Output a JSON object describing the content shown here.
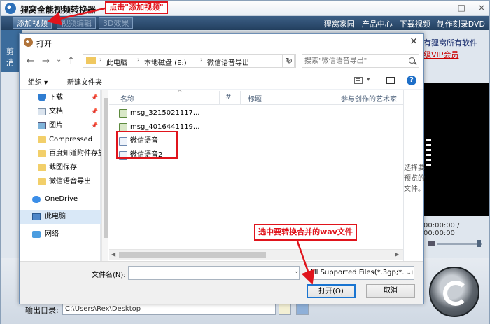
{
  "app": {
    "title": "狸窝全能视频转换器",
    "window_controls": [
      "—",
      "□",
      "×"
    ],
    "toolbar": [
      {
        "label": "添加视频",
        "enabled": true
      },
      {
        "label": "视频编辑",
        "enabled": false
      },
      {
        "label": "3D效果",
        "enabled": false
      }
    ],
    "topnav": [
      "狸窝家园",
      "产品中心",
      "下载视频",
      "制作刻录DVD"
    ],
    "left_strip": [
      "剪",
      "消"
    ],
    "promo_lines": [
      "有狸窝所有软件",
      "级VIP会员"
    ],
    "timecode": "00:00:00 / 00:00:00",
    "output_label": "输出目录:",
    "output_path": "C:\\Users\\Rex\\Desktop"
  },
  "annotations": {
    "step1": "点击\"添加视频\"",
    "step2": "选中要转换合并的wav文件"
  },
  "dialog": {
    "title": "打开",
    "close": "×",
    "nav": {
      "back": "←",
      "forward": "→",
      "down": "⌄",
      "up": "↑"
    },
    "breadcrumb": [
      "此电脑",
      "本地磁盘 (E:)",
      "微信语音导出"
    ],
    "refresh": "↻",
    "search_placeholder": "搜索\"微信语音导出\"",
    "commands": {
      "organize": "组织 ▾",
      "new_folder": "新建文件夹",
      "view_drop": "▾",
      "help": "?"
    },
    "sidebar": [
      {
        "label": "下载",
        "icon": "download-icon",
        "pinned": true
      },
      {
        "label": "文档",
        "icon": "document-icon",
        "pinned": true
      },
      {
        "label": "图片",
        "icon": "picture-icon",
        "pinned": true
      },
      {
        "label": "Compressed",
        "icon": "folder-icon",
        "pinned": false
      },
      {
        "label": "百度知道附件存放",
        "icon": "folder-icon",
        "pinned": false
      },
      {
        "label": "截图保存",
        "icon": "folder-icon",
        "pinned": false
      },
      {
        "label": "微信语音导出",
        "icon": "folder-icon",
        "pinned": false
      },
      {
        "label": "OneDrive",
        "icon": "cloud-icon",
        "pinned": false
      },
      {
        "label": "此电脑",
        "icon": "computer-icon",
        "pinned": false,
        "selected": true
      },
      {
        "label": "网络",
        "icon": "network-icon",
        "pinned": false
      }
    ],
    "pin_glyph": "📌",
    "columns": [
      "名称",
      "#",
      "标题",
      "参与创作的艺术家"
    ],
    "sort_glyph": "^",
    "files": [
      {
        "name": "msg_3215021117...",
        "type": "amr"
      },
      {
        "name": "msg_4016441119...",
        "type": "amr"
      },
      {
        "name": "微信语音",
        "type": "wav"
      },
      {
        "name": "微信语音2",
        "type": "wav"
      }
    ],
    "preview_hint": "选择要预览的文件。",
    "scroll": {
      "left": "◀",
      "right": "▶"
    },
    "filename_label": "文件名(N):",
    "filename_value": "",
    "filename_drop": "⌄",
    "filter": "All Supported Files(*.3gp;*.3g",
    "filter_drop": "⌄",
    "open_button": "打开(O)",
    "cancel_button": "取消"
  }
}
